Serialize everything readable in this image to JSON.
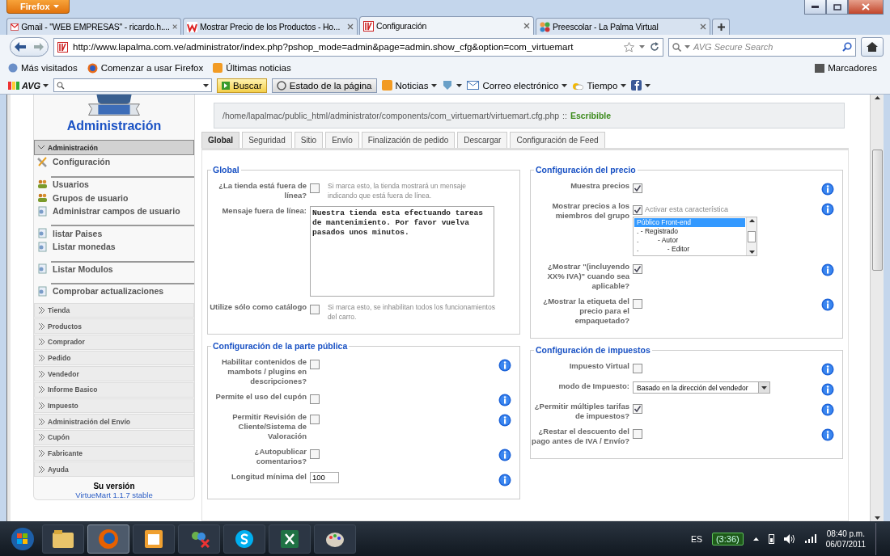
{
  "browser": {
    "menu_button": "Firefox",
    "tabs": [
      {
        "title": "Gmail - \"WEB EMPRESAS\" - ricardo.h....",
        "selected": false
      },
      {
        "title": "Mostrar Precio de los Productos - Ho...",
        "selected": false
      },
      {
        "title": "Configuración",
        "selected": true
      },
      {
        "title": "Preescolar - La Palma Virtual",
        "selected": false
      }
    ],
    "url": "http://www.lapalma.com.ve/administrator/index.php?pshop_mode=admin&page=admin.show_cfg&option=com_virtuemart",
    "search_placeholder": "AVG Secure Search",
    "bookmarks": [
      "Más visitados",
      "Comenzar a usar Firefox",
      "Últimas noticias"
    ],
    "bookmarks_menu": "Marcadores",
    "avg": {
      "logo": "AVG",
      "search_button": "Buscar",
      "page_status": "Estado de la página",
      "news": "Noticias",
      "mail": "Correo electrónico",
      "weather": "Tiempo"
    }
  },
  "sidebar": {
    "title": "Administración",
    "section": {
      "label": "Administración",
      "expanded": true
    },
    "items": [
      {
        "kind": "link",
        "label": "Configuración"
      },
      {
        "kind": "separator"
      },
      {
        "kind": "link",
        "label": "Usuarios"
      },
      {
        "kind": "link",
        "label": "Grupos de usuario"
      },
      {
        "kind": "link",
        "label": "Administrar campos de usuario"
      },
      {
        "kind": "separator"
      },
      {
        "kind": "link",
        "label": "listar Paises"
      },
      {
        "kind": "link",
        "label": "Listar monedas"
      },
      {
        "kind": "separator"
      },
      {
        "kind": "link",
        "label": "Listar Modulos"
      },
      {
        "kind": "separator"
      },
      {
        "kind": "link",
        "label": "Comprobar actualizaciones"
      }
    ],
    "collapsed_sections": [
      {
        "label": "Tienda",
        "expanded": false
      },
      {
        "label": "Productos",
        "expanded": false
      },
      {
        "label": "Comprador",
        "expanded": false
      },
      {
        "label": "Pedido",
        "expanded": false
      },
      {
        "label": "Vendedor",
        "expanded": false
      },
      {
        "label": "Informe Basico",
        "expanded": false
      },
      {
        "label": "Impuesto",
        "expanded": false
      },
      {
        "label": "Administración del Envío",
        "expanded": false
      },
      {
        "label": "Cupón",
        "expanded": false
      },
      {
        "label": "Fabricante",
        "expanded": false
      },
      {
        "label": "Ayuda",
        "expanded": false
      }
    ],
    "version_label": "Su versión",
    "version": "VirtueMart 1.1.7 stable"
  },
  "config_file": {
    "path": "/home/lapalmac/public_html/administrator/components/com_virtuemart/virtuemart.cfg.php",
    "separator": "::",
    "status": "Escribible"
  },
  "tabs": [
    {
      "label": "Global",
      "selected": true
    },
    {
      "label": "Seguridad",
      "selected": false
    },
    {
      "label": "Sitio",
      "selected": false
    },
    {
      "label": "Envío",
      "selected": false
    },
    {
      "label": "Finalización de pedido",
      "selected": false
    },
    {
      "label": "Descargar",
      "selected": false
    },
    {
      "label": "Configuración de Feed",
      "selected": false
    }
  ],
  "columns": [
    [
      {
        "title": "Global",
        "rows": [
          {
            "kind": "checkbox",
            "label": "¿La tienda está fuera de línea?",
            "checked": false,
            "description": "Si marca esto, la tienda mostrará un mensaje indicando que está fuera de línea.",
            "info": false
          },
          {
            "kind": "textarea",
            "label": "Mensaje fuera de línea:",
            "value": "Nuestra tienda esta efectuando tareas de mantenimiento. Por favor vuelva pasados unos minutos.",
            "info": false
          },
          {
            "kind": "checkbox",
            "label": "Utilize sólo como catálogo",
            "checked": false,
            "description": "Si marca esto, se inhabilitan todos los funcionamientos del carro.",
            "info": false
          }
        ]
      },
      {
        "title": "Configuración de la parte pública",
        "rows": [
          {
            "kind": "checkbox",
            "label": "Habilitar contenidos de mambots / plugins en descripciones?",
            "checked": false,
            "info": true
          },
          {
            "kind": "checkbox",
            "label": "Permite el uso del cupón",
            "checked": false,
            "info": true
          },
          {
            "kind": "checkbox",
            "label": "Permitir Revisión de Cliente/Sistema de Valoración",
            "checked": false,
            "info": true
          },
          {
            "kind": "checkbox",
            "label": "¿Autopublicar comentarios?",
            "checked": false,
            "info": true
          },
          {
            "kind": "text",
            "label": "Longitud mínima del",
            "value": "100",
            "info": true
          }
        ]
      }
    ],
    [
      {
        "title": "Configuración del precio",
        "rows": [
          {
            "kind": "checkbox",
            "label": "Muestra precios",
            "checked": true,
            "info": true
          },
          {
            "kind": "grouplist",
            "label": "Mostrar precios a los miembros del grupo",
            "checked": true,
            "option": "Activar esta característica",
            "info": true,
            "groups": [
              {
                "label": "Público Front-end",
                "selected": true
              },
              {
                "label": ". - Registrado",
                "selected": false
              },
              {
                "label": ".          - Autor",
                "selected": false
              },
              {
                "label": ".               - Editor",
                "selected": false
              }
            ]
          },
          {
            "kind": "checkbox",
            "label": "¿Mostrar \"(incluyendo XX% IVA)\" cuando sea aplicable?",
            "checked": true,
            "info": true
          },
          {
            "kind": "checkbox",
            "label": "¿Mostrar la etiqueta del precio para el empaquetado?",
            "checked": false,
            "info": true
          }
        ]
      },
      {
        "title": "Configuración de impuestos",
        "rows": [
          {
            "kind": "checkbox",
            "label": "Impuesto Virtual",
            "checked": false,
            "info": true
          },
          {
            "kind": "select",
            "label": "modo de Impuesto:",
            "value": "Basado en la dirección del vendedor",
            "info": true
          },
          {
            "kind": "checkbox",
            "label": "¿Permitir múltiples tarifas de impuestos?",
            "checked": true,
            "info": true
          },
          {
            "kind": "checkbox",
            "label": "¿Restar el descuento del pago antes de IVA / Envío?",
            "checked": false,
            "info": true
          }
        ]
      }
    ]
  ],
  "taskbar": {
    "language": "ES",
    "battery": "(3:36)",
    "time": "08:40 p.m.",
    "date": "06/07/2011"
  }
}
